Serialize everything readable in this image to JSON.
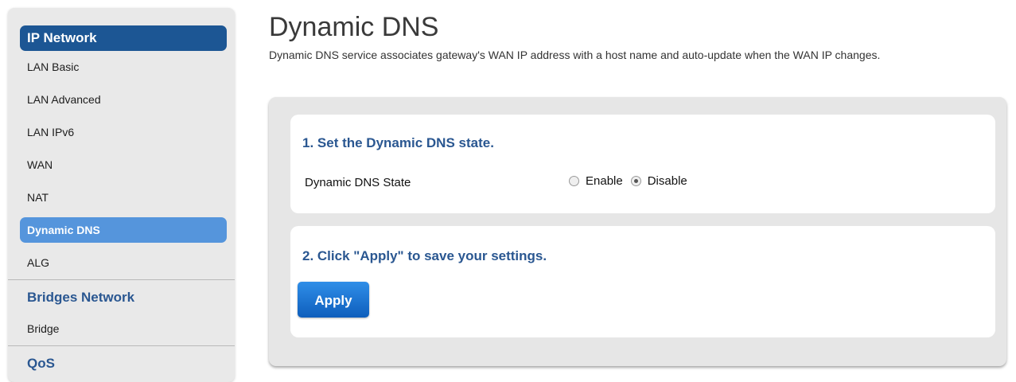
{
  "sidebar": {
    "sections": [
      {
        "title": "IP Network",
        "items": [
          "LAN Basic",
          "LAN Advanced",
          "LAN IPv6",
          "WAN",
          "NAT",
          "Dynamic DNS",
          "ALG"
        ]
      },
      {
        "title": "Bridges Network",
        "items": [
          "Bridge"
        ]
      },
      {
        "title": "QoS",
        "items": []
      }
    ]
  },
  "main": {
    "title": "Dynamic DNS",
    "description": "Dynamic DNS service associates gateway's WAN IP address with a host name and auto-update when the WAN IP changes.",
    "step1": {
      "heading": "1. Set the Dynamic DNS state.",
      "field_label": "Dynamic DNS State",
      "options": [
        "Enable",
        "Disable"
      ],
      "selected": "Disable"
    },
    "step2": {
      "heading": "2. Click \"Apply\" to save your settings.",
      "apply_label": "Apply"
    }
  },
  "colors": {
    "accent_dark": "#1c5694",
    "accent_light": "#5595dc",
    "heading_blue": "#2a5791",
    "button_blue": "#0e5ebc"
  }
}
